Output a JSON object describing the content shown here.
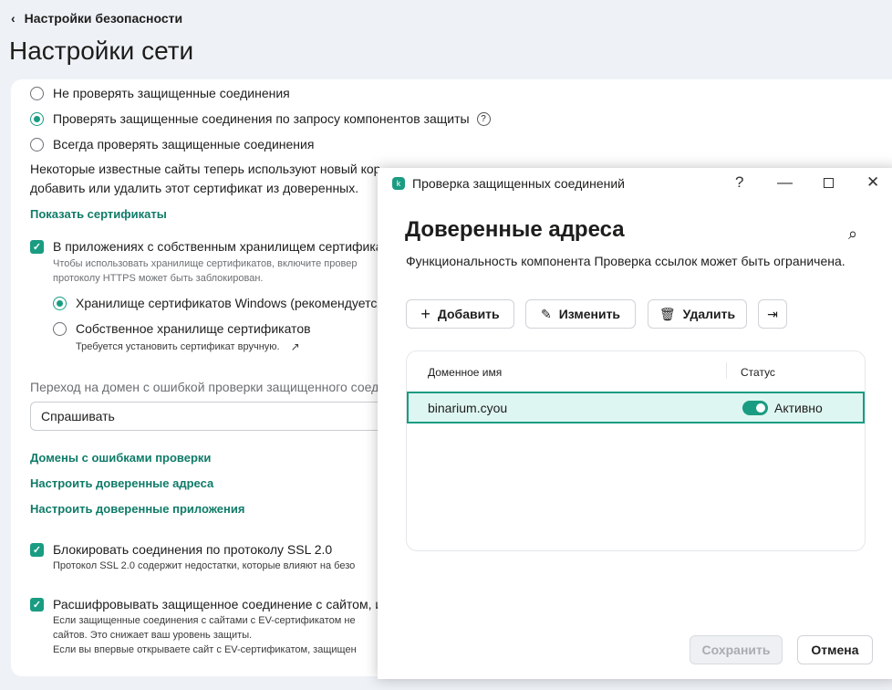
{
  "header": {
    "back_label": "Настройки безопасности",
    "title": "Настройки сети"
  },
  "settings": {
    "radios": [
      "Не проверять защищенные соединения",
      "Проверять защищенные соединения по запросу компонентов защиты",
      "Всегда проверять защищенные соединения"
    ],
    "info_line1": "Некоторые известные сайты теперь используют новый кор",
    "info_line2": "добавить или удалить этот сертификат из доверенных.",
    "show_certs": "Показать сертификаты",
    "own_store_label": "В приложениях с собственным хранилищем сертифика",
    "own_store_sub1": "Чтобы использовать хранилище сертификатов, включите провер",
    "own_store_sub2": "протоколу HTTPS может быть заблокирован.",
    "store_windows": "Хранилище сертификатов Windows (рекомендуется",
    "store_own": "Собственное хранилище сертификатов",
    "store_own_sub": "Требуется установить сертификат вручную.",
    "domain_error_label": "Переход на домен с ошибкой проверки защищенного соед",
    "domain_error_value": "Спрашивать",
    "link_domains": "Домены с ошибками проверки",
    "link_trusted_addr": "Настроить доверенные адреса",
    "link_trusted_apps": "Настроить доверенные приложения",
    "ssl_label": "Блокировать соединения по протоколу SSL 2.0",
    "ssl_sub": "Протокол SSL 2.0 содержит недостатки, которые влияют на безо",
    "ev_label": "Расшифровывать защищенное соединение с сайтом, и",
    "ev_sub1": "Если защищенные соединения с сайтами с EV-сертификатом не",
    "ev_sub2": "сайтов. Это снижает ваш уровень защиты.",
    "ev_sub3": "Если вы впервые открываете сайт с EV-сертификатом, защищен"
  },
  "dialog": {
    "window_title": "Проверка защищенных соединений",
    "logo_letter": "k",
    "heading": "Доверенные адреса",
    "description": "Функциональность компонента Проверка ссылок может быть ограничена.",
    "add": "Добавить",
    "edit": "Изменить",
    "delete": "Удалить",
    "columns": [
      "Доменное имя",
      "Статус"
    ],
    "rows": [
      {
        "domain": "binarium.cyou",
        "status": "Активно",
        "enabled": true
      }
    ],
    "save": "Сохранить",
    "cancel": "Отмена"
  }
}
